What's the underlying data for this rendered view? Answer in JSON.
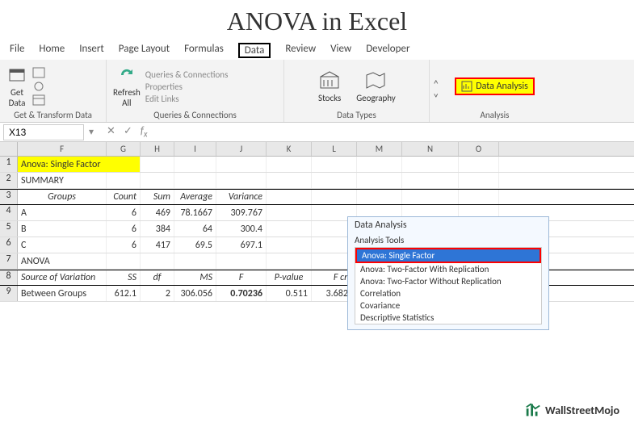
{
  "title": "ANOVA in Excel",
  "tabs": [
    "File",
    "Home",
    "Insert",
    "Page Layout",
    "Formulas",
    "Data",
    "Review",
    "View",
    "Developer"
  ],
  "activeTab": "Data",
  "ribbon": {
    "getData": {
      "label": "Get\nData",
      "group": "Get & Transform Data"
    },
    "refresh": {
      "label": "Refresh\nAll",
      "group": "Queries & Connections"
    },
    "qlinks": [
      "Queries & Connections",
      "Properties",
      "Edit Links"
    ],
    "datatypes": {
      "stocks": "Stocks",
      "geo": "Geography",
      "group": "Data Types"
    },
    "analysis": {
      "btn": "Data Analysis",
      "group": "Analysis"
    }
  },
  "namebox": "X13",
  "cols": [
    "F",
    "G",
    "H",
    "I",
    "J",
    "K",
    "L",
    "M",
    "N",
    "O"
  ],
  "sheet": {
    "r1_title": "Anova: Single Factor",
    "r2": "SUMMARY",
    "hdr1": {
      "groups": "Groups",
      "count": "Count",
      "sum": "Sum",
      "avg": "Average",
      "var": "Variance"
    },
    "data1": [
      {
        "g": "A",
        "c": "6",
        "s": "469",
        "a": "78.1667",
        "v": "309.767"
      },
      {
        "g": "B",
        "c": "6",
        "s": "384",
        "a": "64",
        "v": "300.4"
      },
      {
        "g": "C",
        "c": "6",
        "s": "417",
        "a": "69.5",
        "v": "697.1"
      }
    ],
    "r7": "ANOVA",
    "hdr2": {
      "src": "Source of Variation",
      "ss": "SS",
      "df": "df",
      "ms": "MS",
      "f": "F",
      "p": "P-value",
      "fc": "F crit"
    },
    "data2": {
      "src": "Between Groups",
      "ss": "612.1",
      "df": "2",
      "ms": "306.056",
      "f": "0.70236",
      "p": "0.511",
      "fc": "3.6823"
    }
  },
  "dialog": {
    "title": "Data Analysis",
    "label": "Analysis Tools",
    "items": [
      "Anova: Single Factor",
      "Anova: Two-Factor With Replication",
      "Anova: Two-Factor Without Replication",
      "Correlation",
      "Covariance",
      "Descriptive Statistics"
    ]
  },
  "logo": "WallStreetMojo",
  "chart_data": {
    "type": "table",
    "title": "Anova: Single Factor",
    "summary": {
      "columns": [
        "Groups",
        "Count",
        "Sum",
        "Average",
        "Variance"
      ],
      "rows": [
        [
          "A",
          6,
          469,
          78.1667,
          309.767
        ],
        [
          "B",
          6,
          384,
          64,
          300.4
        ],
        [
          "C",
          6,
          417,
          69.5,
          697.1
        ]
      ]
    },
    "anova": {
      "columns": [
        "Source of Variation",
        "SS",
        "df",
        "MS",
        "F",
        "P-value",
        "F crit"
      ],
      "rows": [
        [
          "Between Groups",
          612.1,
          2,
          306.056,
          0.70236,
          0.511,
          3.6823
        ]
      ]
    }
  }
}
